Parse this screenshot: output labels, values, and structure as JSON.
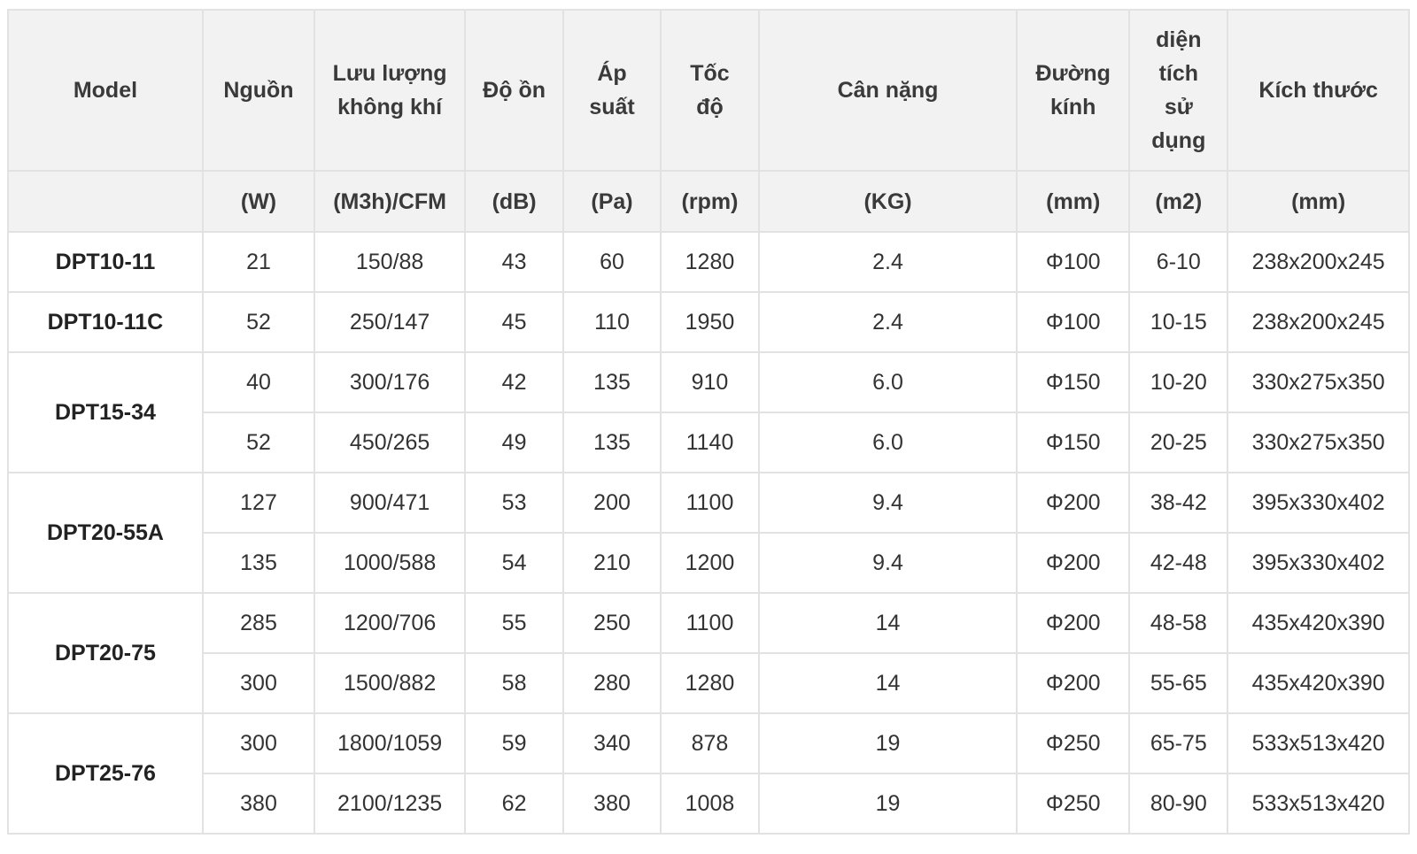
{
  "table": {
    "headers": [
      "Model",
      "Nguồn",
      "Lưu lượng không khí",
      "Độ ồn",
      "Áp suất",
      "Tốc độ",
      "Cân nặng",
      "Đường kính",
      "diện tích sử dụng",
      "Kích thước"
    ],
    "units": [
      "",
      "(W)",
      "(M3h)/CFM",
      "(dB)",
      "(Pa)",
      "(rpm)",
      "(KG)",
      "(mm)",
      "(m2)",
      "(mm)"
    ],
    "rows": [
      [
        "DPT10-11",
        "21",
        "150/88",
        "43",
        "60",
        "1280",
        "2.4",
        "Φ100",
        "6-10",
        "238x200x245"
      ],
      [
        "DPT10-11C",
        "52",
        "250/147",
        "45",
        "110",
        "1950",
        "2.4",
        "Φ100",
        "10-15",
        "238x200x245"
      ],
      [
        "DPT15-34",
        "40",
        "300/176",
        "42",
        "135",
        "910",
        "6.0",
        "Φ150",
        "10-20",
        "330x275x350"
      ],
      [
        "",
        "52",
        "450/265",
        "49",
        "135",
        "1140",
        "6.0",
        "Φ150",
        "20-25",
        "330x275x350"
      ],
      [
        "DPT20-55A",
        "127",
        "900/471",
        "53",
        "200",
        "1100",
        "9.4",
        "Φ200",
        "38-42",
        "395x330x402"
      ],
      [
        "",
        "135",
        "1000/588",
        "54",
        "210",
        "1200",
        "9.4",
        "Φ200",
        "42-48",
        "395x330x402"
      ],
      [
        "DPT20-75",
        "285",
        "1200/706",
        "55",
        "250",
        "1100",
        "14",
        "Φ200",
        "48-58",
        "435x420x390"
      ],
      [
        "",
        "300",
        "1500/882",
        "58",
        "280",
        "1280",
        "14",
        "Φ200",
        "55-65",
        "435x420x390"
      ],
      [
        "DPT25-76",
        "300",
        "1800/1059",
        "59",
        "340",
        "878",
        "19",
        "Φ250",
        "65-75",
        "533x513x420"
      ],
      [
        "",
        "380",
        "2100/1235",
        "62",
        "380",
        "1008",
        "19",
        "Φ250",
        "80-90",
        "533x513x420"
      ]
    ]
  }
}
